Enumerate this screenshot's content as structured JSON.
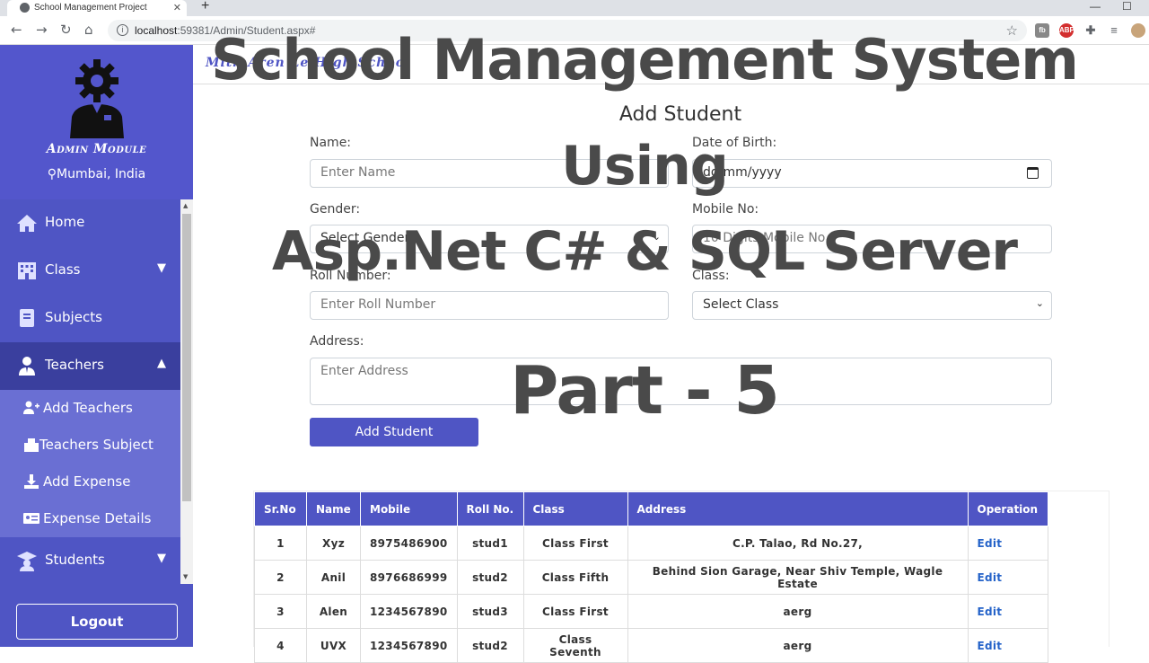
{
  "browser": {
    "tab_title": "School Management Project",
    "url_host": "localhost",
    "url_rest": ":59381/Admin/Student.aspx#"
  },
  "sidebar": {
    "brand_title": "Admin Module",
    "location": "Mumbai, India",
    "items": [
      {
        "label": "Home",
        "icon": "home-icon"
      },
      {
        "label": "Class",
        "icon": "building-icon",
        "chevron": "down"
      },
      {
        "label": "Subjects",
        "icon": "book-icon"
      },
      {
        "label": "Teachers",
        "icon": "teacher-icon",
        "chevron": "up"
      },
      {
        "label": "Students",
        "icon": "graduation-cap-icon",
        "chevron": "down"
      }
    ],
    "subitems": [
      {
        "label": "Add Teachers",
        "icon": "user-plus-icon"
      },
      {
        "label": "Teachers Subject",
        "icon": "books-icon"
      },
      {
        "label": "Add Expense",
        "icon": "download-icon"
      },
      {
        "label": "Expense Details",
        "icon": "id-card-icon"
      }
    ],
    "logout_label": "Logout"
  },
  "header": {
    "school_name": "Mith Aren Le High Schoo"
  },
  "form": {
    "title": "Add Student",
    "name_label": "Name:",
    "name_placeholder": "Enter Name",
    "dob_label": "Date of Birth:",
    "dob_placeholder": "dd/mm/yyyy",
    "gender_label": "Gender:",
    "gender_placeholder": "Select Gender",
    "mobile_label": "Mobile No:",
    "mobile_placeholder": "10 Digits Mobile No",
    "roll_label": "Roll Number:",
    "roll_placeholder": "Enter Roll Number",
    "class_label": "Class:",
    "class_placeholder": "Select Class",
    "address_label": "Address:",
    "address_placeholder": "Enter Address",
    "submit_label": "Add Student"
  },
  "table": {
    "headers": [
      "Sr.No",
      "Name",
      "Mobile",
      "Roll No.",
      "Class",
      "Address",
      "Operation"
    ],
    "rows": [
      [
        "1",
        "Xyz",
        "8975486900",
        "stud1",
        "Class First",
        "C.P. Talao, Rd No.27,",
        "Edit"
      ],
      [
        "2",
        "Anil",
        "8976686999",
        "stud2",
        "Class Fifth",
        "Behind Sion Garage, Near Shiv Temple, Wagle Estate",
        "Edit"
      ],
      [
        "3",
        "Alen",
        "1234567890",
        "stud3",
        "Class First",
        "aerg",
        "Edit"
      ],
      [
        "4",
        "UVX",
        "1234567890",
        "stud2",
        "Class Seventh",
        "aerg",
        "Edit"
      ]
    ]
  },
  "overlay": {
    "line1": "School Management System",
    "line2": "Using",
    "line3": "Asp.Net C# & SQL Server",
    "line4": "Part - 5"
  },
  "colors": {
    "sidebar": "#4f55c4",
    "active_item": "#3a3f9e",
    "submenu": "#6a6fd3",
    "link": "#2563c9"
  }
}
